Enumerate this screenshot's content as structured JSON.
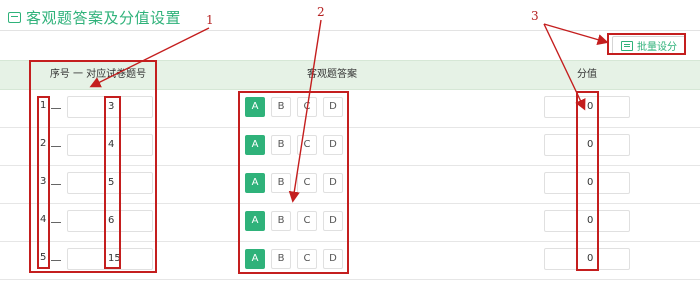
{
  "header": {
    "title": "客观题答案及分值设置",
    "icon": "list-icon"
  },
  "toolbar": {
    "batch_label": "批量设分"
  },
  "table": {
    "columns": {
      "seq": "序号 一 对应试卷题号",
      "answer": "客观题答案",
      "score": "分值"
    },
    "options": [
      "A",
      "B",
      "C",
      "D"
    ],
    "rows": [
      {
        "seq": "1",
        "question_no": "3",
        "selected": "A",
        "score": "0"
      },
      {
        "seq": "2",
        "question_no": "4",
        "selected": "A",
        "score": "0"
      },
      {
        "seq": "3",
        "question_no": "5",
        "selected": "A",
        "score": "0"
      },
      {
        "seq": "4",
        "question_no": "6",
        "selected": "A",
        "score": "0"
      },
      {
        "seq": "5",
        "question_no": "15",
        "selected": "A",
        "score": "0"
      }
    ]
  },
  "annotations": {
    "n1": "1",
    "n2": "2",
    "n3": "3"
  },
  "colors": {
    "accent": "#2fb27a",
    "header_bg": "#e6f2e6",
    "annotation": "#c41e1e"
  }
}
